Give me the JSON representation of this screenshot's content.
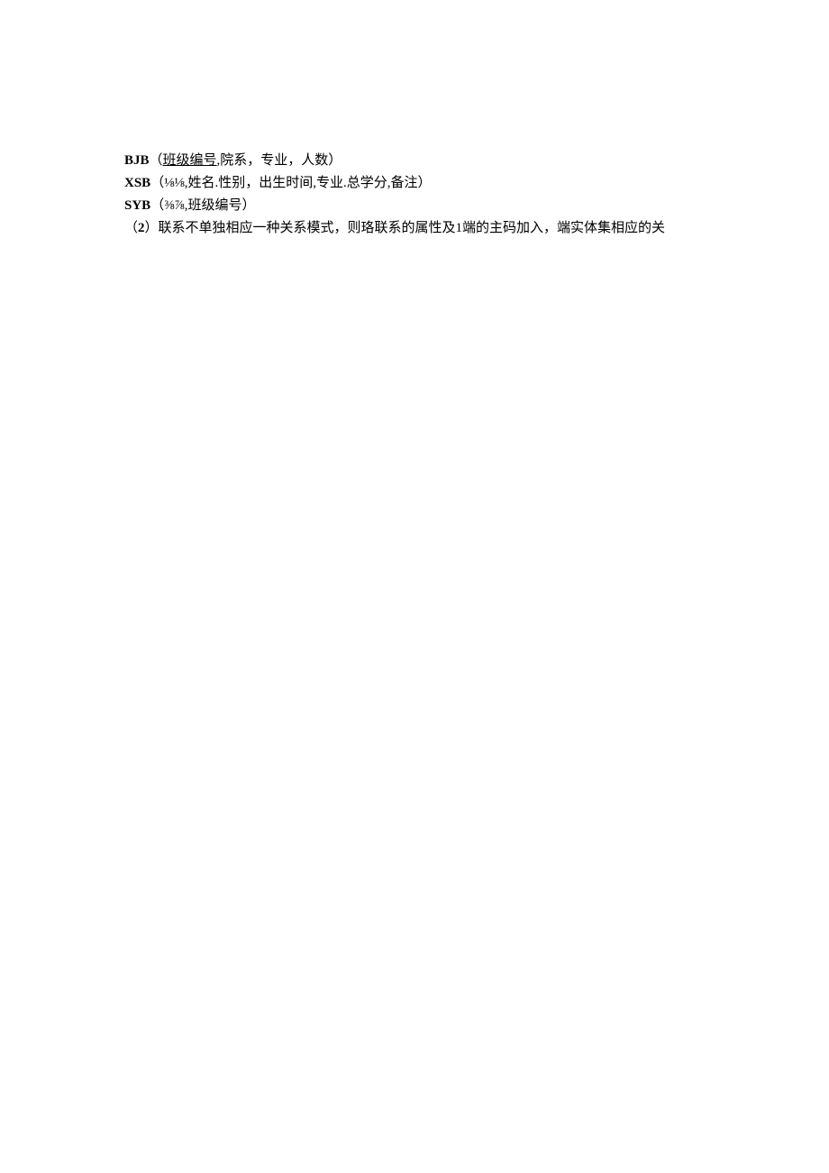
{
  "lines": {
    "line1": {
      "label": "BJB",
      "paren_open": "（",
      "underlined": "班级编号",
      "rest": ",院系，专业，人数）"
    },
    "line2": {
      "label": "XSB",
      "rest": "（⅛⅛,姓名.性别，出生时间,专业.总学分,备注）"
    },
    "line3": {
      "label": "SYB",
      "rest": "（⅜⅞,班级编号）"
    },
    "line4": {
      "prefix": "（",
      "num": "2",
      "rest": "）联系不单独相应一种关系模式，则珞联系的属性及1端的主码加入，端实体集相应的关"
    }
  }
}
